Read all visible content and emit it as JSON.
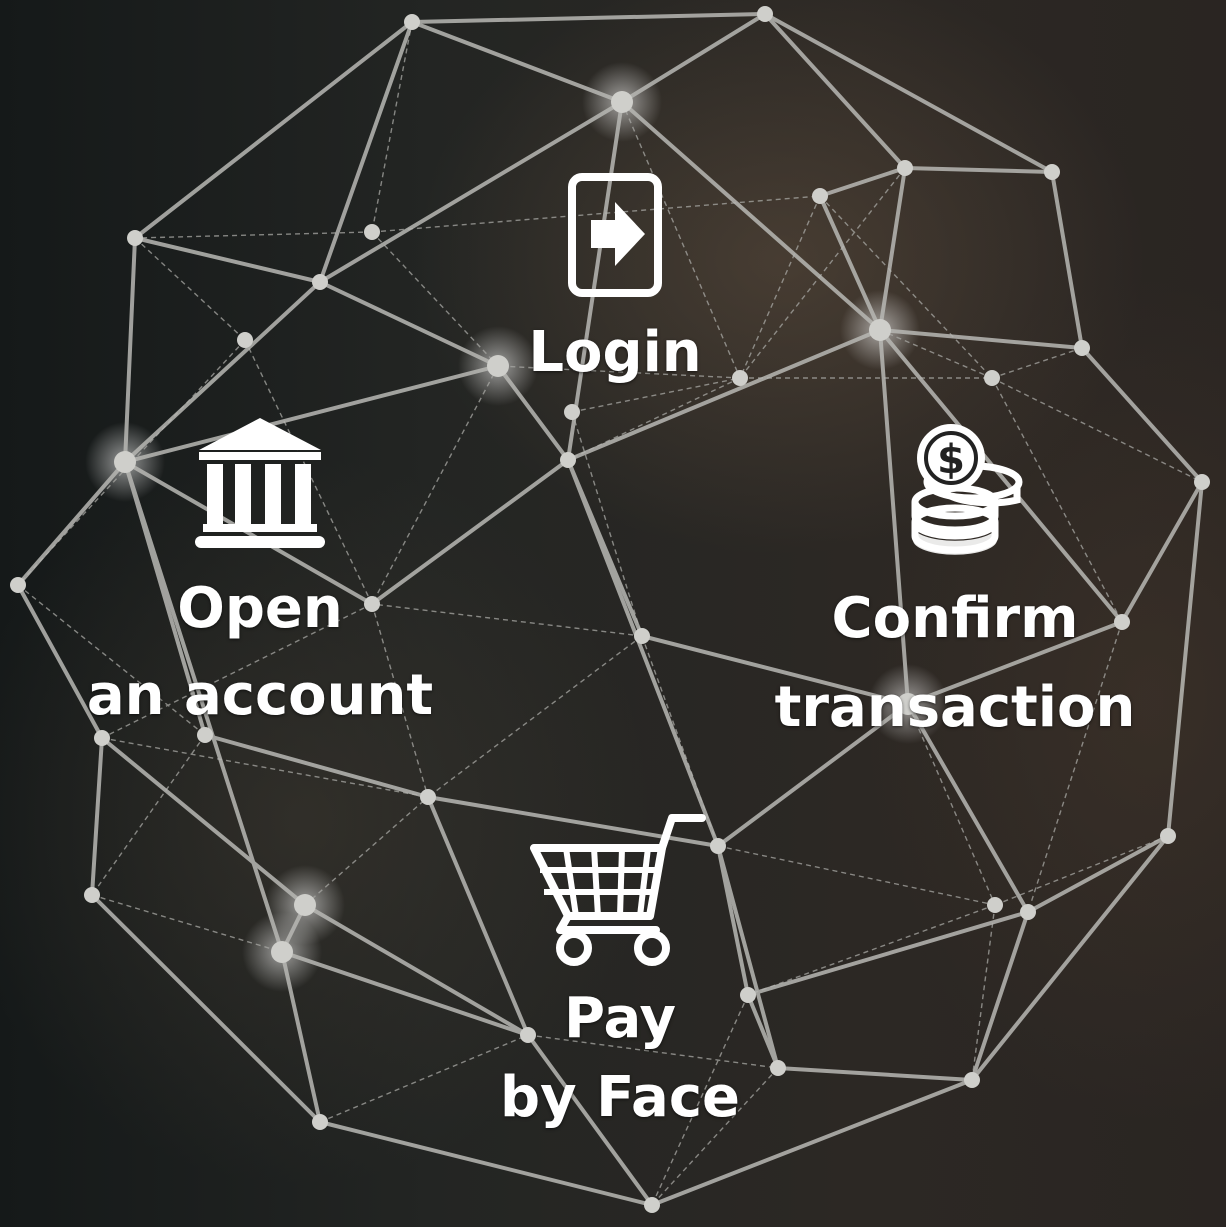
{
  "features": {
    "login": {
      "label": "Login",
      "icon": "login-door-arrow-icon"
    },
    "open_account": {
      "line1": "Open",
      "line2": "an account",
      "icon": "bank-building-icon"
    },
    "confirm_transaction": {
      "line1": "Confirm",
      "line2": "transaction",
      "icon": "coin-stack-dollar-icon"
    },
    "pay_by_face": {
      "line1": "Pay",
      "line2": "by Face",
      "icon": "shopping-cart-icon"
    }
  },
  "colors": {
    "text": "#ffffff",
    "mesh_lines": "#b8b8b4",
    "nodes": "#d8d8d4",
    "background_left": "#151919",
    "background_right": "#2a2522"
  }
}
